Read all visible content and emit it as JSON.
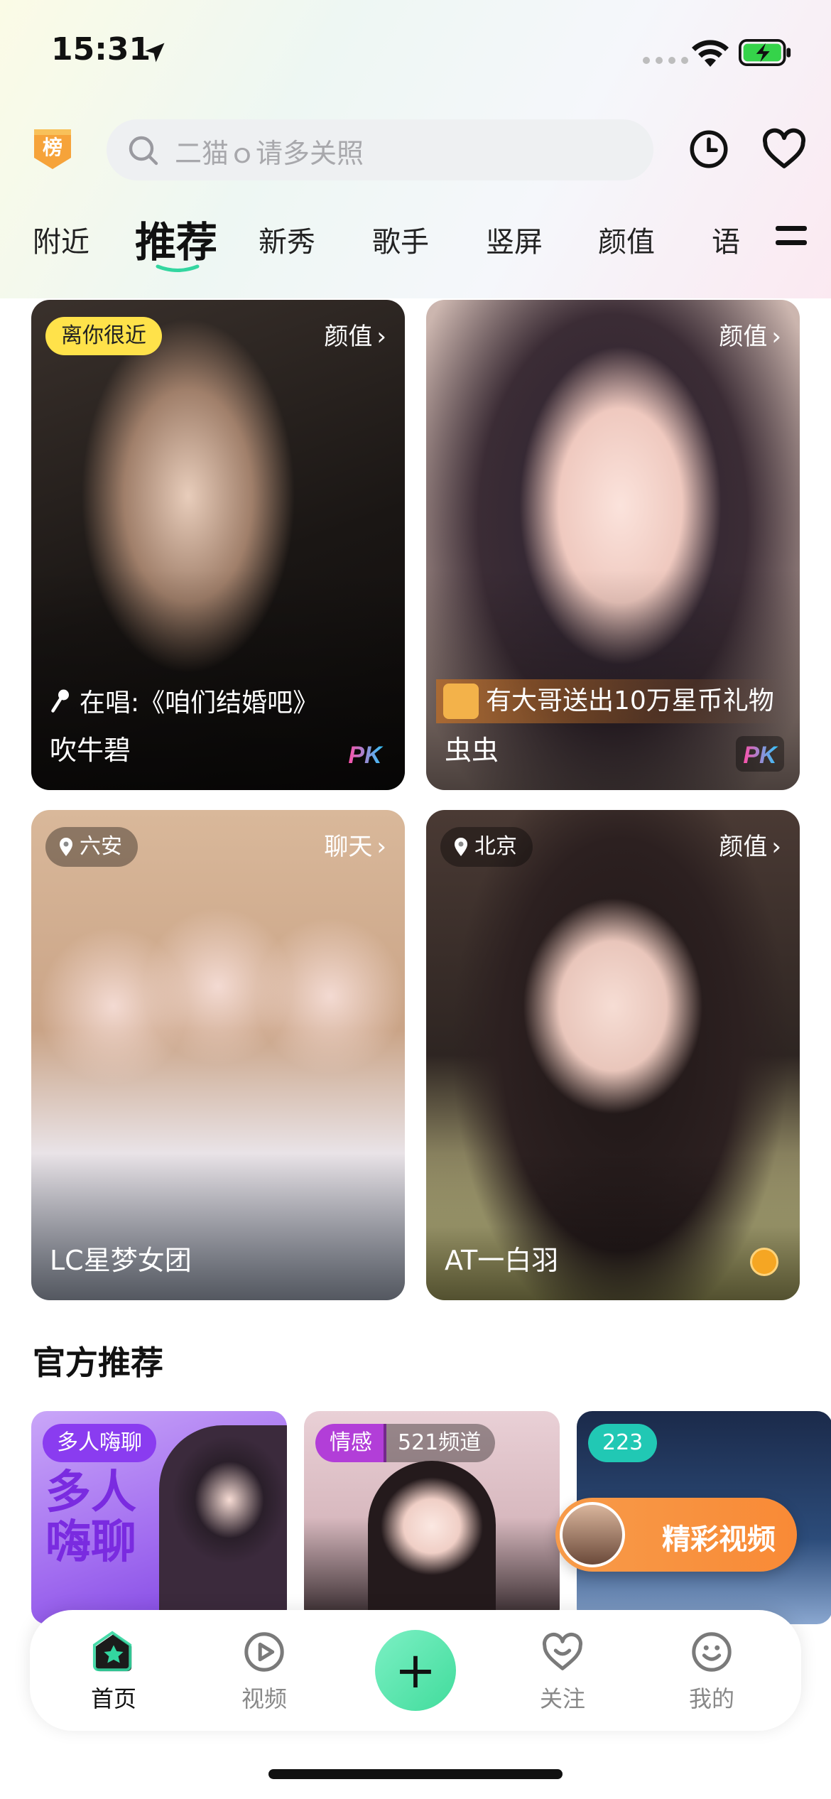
{
  "status_bar": {
    "time": "15:31"
  },
  "header": {
    "rank_badge": "榜",
    "search_placeholder": "二猫ｏ请多关照"
  },
  "tabs": [
    {
      "label": "附近"
    },
    {
      "label": "推荐",
      "active": true
    },
    {
      "label": "新秀"
    },
    {
      "label": "歌手"
    },
    {
      "label": "竖屏"
    },
    {
      "label": "颜值"
    },
    {
      "label": "语"
    }
  ],
  "cards": [
    {
      "badge": "离你很近",
      "category": "颜值",
      "activity": "在唱:《咱们结婚吧》",
      "name": "吹牛碧",
      "pk": "PK"
    },
    {
      "category": "颜值",
      "activity": "有大哥送出10万星币礼物",
      "name": "虫虫",
      "pk": "PK"
    },
    {
      "location": "六安",
      "category": "聊天",
      "name": "LC星梦女团"
    },
    {
      "location": "北京",
      "category": "颜值",
      "name": "AT一白羽"
    }
  ],
  "section": {
    "title": "官方推荐"
  },
  "recommend": [
    {
      "tag": "多人嗨聊",
      "big_text": "多人嗨聊",
      "color": "#8a3cf0"
    },
    {
      "tag": "情感",
      "sub": "521频道",
      "color": "#b23ed8"
    },
    {
      "tag": "223",
      "color": "#21c8b4"
    }
  ],
  "floating": {
    "label": "精彩视频"
  },
  "tabbar": [
    {
      "label": "首页",
      "icon": "home-icon",
      "active": true
    },
    {
      "label": "视频",
      "icon": "play-icon"
    },
    {
      "label": "+",
      "icon": "plus-icon"
    },
    {
      "label": "关注",
      "icon": "heart-face-icon"
    },
    {
      "label": "我的",
      "icon": "smile-icon"
    }
  ],
  "colors": {
    "accent": "#33d6a0",
    "badge_yellow": "#ffe24a",
    "rank_orange": "#f6a33a"
  }
}
